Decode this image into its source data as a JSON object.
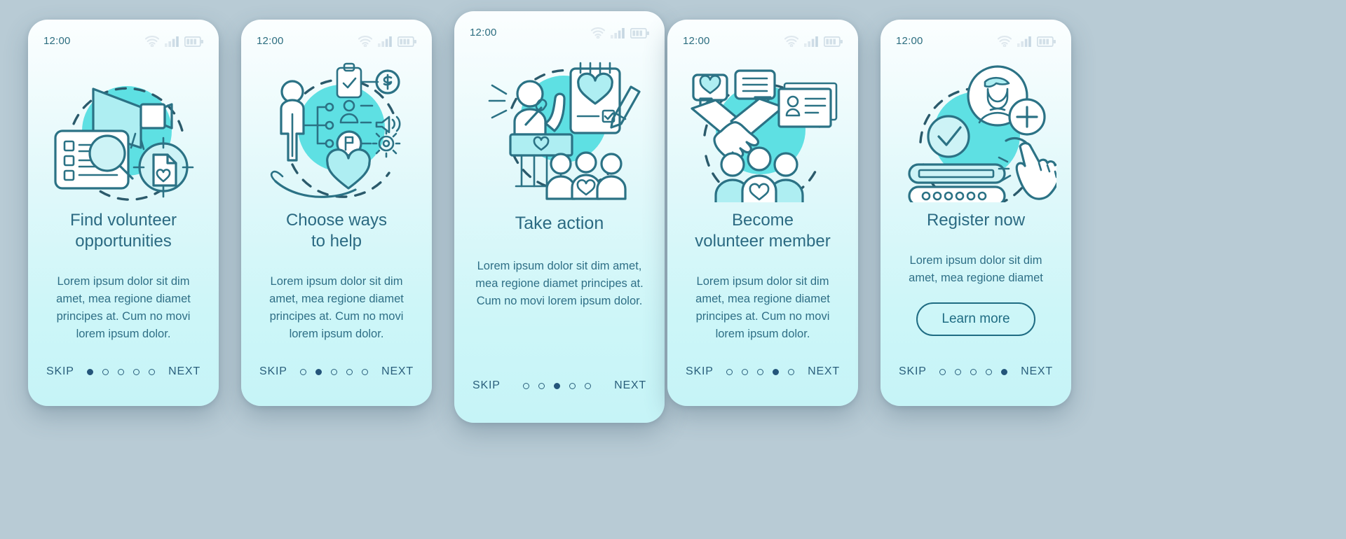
{
  "theme": {
    "background": "#b8cbd5",
    "card_gradient_top": "#fbfeff",
    "card_gradient_bottom": "#c6f4f7",
    "accent": "#5ee0e3",
    "line": "#2b7285",
    "text": "#2b6a82",
    "nav_text": "#2a5f7c",
    "cta_border": "#1f6c83"
  },
  "status_bar": {
    "time": "12:00",
    "icons": [
      "wifi-icon",
      "signal-icon",
      "battery-icon"
    ]
  },
  "nav": {
    "skip_label": "SKIP",
    "next_label": "NEXT",
    "total_dots": 5
  },
  "screens": [
    {
      "id": "find-volunteer-opportunities",
      "illustration": "megaphone-search-target-illustration",
      "title_lines": [
        "Find volunteer",
        "opportunities"
      ],
      "description": "Lorem ipsum dolor sit dim amet, mea regione diamet principes at. Cum no movi lorem ipsum dolor.",
      "active_dot": 1,
      "elevated": false,
      "cta": null
    },
    {
      "id": "choose-ways-to-help",
      "illustration": "person-options-heart-illustration",
      "title_lines": [
        "Choose ways",
        "to help"
      ],
      "description": "Lorem ipsum dolor sit dim amet, mea regione diamet principes at. Cum no movi lorem ipsum dolor.",
      "active_dot": 2,
      "elevated": false,
      "cta": null
    },
    {
      "id": "take-action",
      "illustration": "speaker-crowd-notebook-illustration",
      "title_lines": [
        "Take action"
      ],
      "description": "Lorem ipsum dolor sit dim amet, mea regione diamet principes at. Cum no movi lorem ipsum dolor.",
      "active_dot": 3,
      "elevated": true,
      "cta": null
    },
    {
      "id": "become-volunteer-member",
      "illustration": "handshake-idcard-group-illustration",
      "title_lines": [
        "Become",
        "volunteer member"
      ],
      "description": "Lorem ipsum dolor sit dim amet, mea regione diamet principes at. Cum no movi lorem ipsum dolor.",
      "active_dot": 4,
      "elevated": false,
      "cta": null
    },
    {
      "id": "register-now",
      "illustration": "add-user-form-hand-illustration",
      "title_lines": [
        "Register now"
      ],
      "description": "Lorem ipsum dolor sit dim amet, mea regione diamet",
      "active_dot": 5,
      "elevated": false,
      "cta": "Learn more"
    }
  ]
}
